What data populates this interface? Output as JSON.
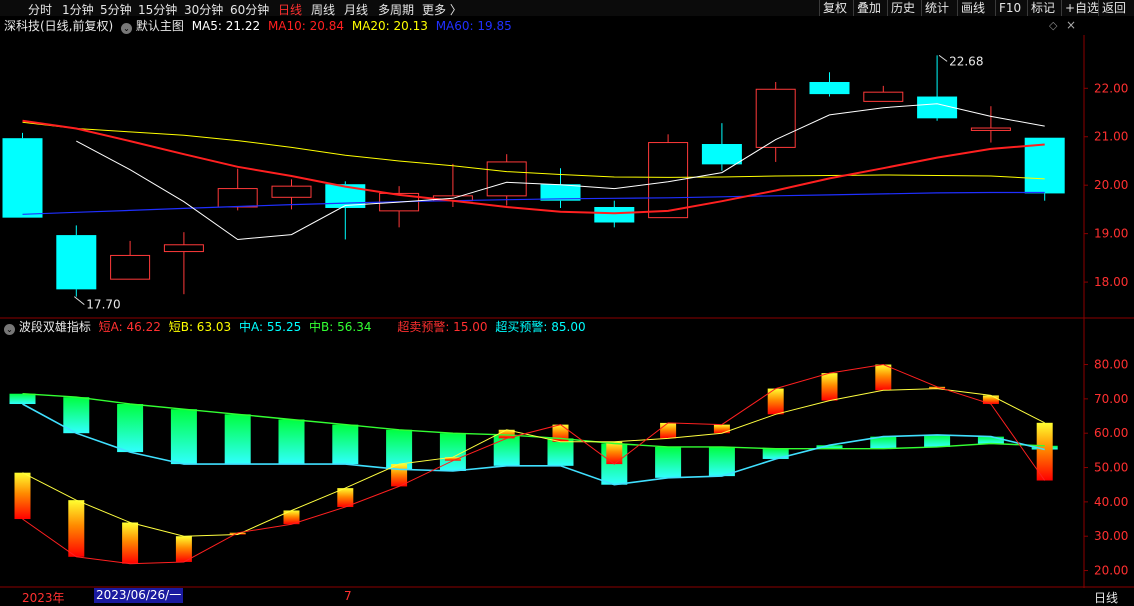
{
  "toolbar": {
    "periods": [
      "分时",
      "1分钟",
      "5分钟",
      "15分钟",
      "30分钟",
      "60分钟",
      "日线",
      "周线",
      "月线",
      "多周期",
      "更多 〉"
    ],
    "active_period": "日线",
    "buttons": [
      "复权",
      "叠加",
      "历史",
      "统计",
      "画线",
      "F10",
      "标记",
      "+自选",
      "返回"
    ]
  },
  "main_info": {
    "stock": "深科技(日线,前复权)",
    "template": "默认主图",
    "ma5": "MA5: 21.22",
    "ma10": "MA10: 20.84",
    "ma20": "MA20: 20.13",
    "ma60": "MA60: 19.85"
  },
  "sub_info": {
    "name": "波段双雄指标",
    "a": "短A: 46.22",
    "b": "短B: 63.03",
    "c": "中A: 55.25",
    "d": "中B: 56.34",
    "oversold": "超卖预警: 15.00",
    "overbought": "超买预警: 85.00"
  },
  "bottom": {
    "year": "2023年",
    "cursor_date": "2023/06/26/一",
    "month": "7",
    "period_label": "日线"
  },
  "colors": {
    "up": "#ff3a3a",
    "down": "#00ffff",
    "ma5": "#ffffff",
    "ma10": "#ff2020",
    "ma20": "#ffff00",
    "ma60": "#1f2fff",
    "axis": "#8b0000"
  },
  "chart_data": [
    {
      "type": "candlestick",
      "title": "深科技(日线,前复权)",
      "ylim": [
        17.3,
        23.1
      ],
      "yticks": [
        "18.00",
        "19.00",
        "20.00",
        "21.00",
        "22.00"
      ],
      "annotations": {
        "high": "22.68",
        "low": "17.70"
      },
      "candles": [
        {
          "o": 20.97,
          "h": 21.08,
          "l": 19.33,
          "c": 19.33
        },
        {
          "o": 18.97,
          "h": 19.17,
          "l": 17.7,
          "c": 17.85
        },
        {
          "o": 18.06,
          "h": 18.85,
          "l": 18.06,
          "c": 18.55
        },
        {
          "o": 18.63,
          "h": 19.03,
          "l": 17.75,
          "c": 18.77
        },
        {
          "o": 19.55,
          "h": 20.34,
          "l": 19.48,
          "c": 19.93
        },
        {
          "o": 19.75,
          "h": 20.12,
          "l": 19.5,
          "c": 19.98
        },
        {
          "o": 20.02,
          "h": 20.08,
          "l": 18.88,
          "c": 19.53
        },
        {
          "o": 19.47,
          "h": 19.98,
          "l": 19.13,
          "c": 19.83
        },
        {
          "o": 19.68,
          "h": 20.44,
          "l": 19.55,
          "c": 19.78
        },
        {
          "o": 19.78,
          "h": 20.64,
          "l": 19.58,
          "c": 20.48
        },
        {
          "o": 20.02,
          "h": 20.35,
          "l": 19.53,
          "c": 19.68
        },
        {
          "o": 19.55,
          "h": 19.68,
          "l": 19.13,
          "c": 19.23
        },
        {
          "o": 19.33,
          "h": 21.05,
          "l": 19.33,
          "c": 20.88
        },
        {
          "o": 20.85,
          "h": 21.28,
          "l": 20.3,
          "c": 20.43
        },
        {
          "o": 20.78,
          "h": 22.13,
          "l": 20.48,
          "c": 21.98
        },
        {
          "o": 22.13,
          "h": 22.33,
          "l": 21.83,
          "c": 21.88
        },
        {
          "o": 21.73,
          "h": 22.05,
          "l": 21.73,
          "c": 21.92
        },
        {
          "o": 21.83,
          "h": 22.68,
          "l": 21.33,
          "c": 21.38
        },
        {
          "o": 21.13,
          "h": 21.63,
          "l": 20.88,
          "c": 21.18
        },
        {
          "o": 20.98,
          "h": 20.98,
          "l": 19.68,
          "c": 19.83
        }
      ],
      "ma5": [
        null,
        20.91,
        20.32,
        19.66,
        18.88,
        18.98,
        19.58,
        19.65,
        19.73,
        20.06,
        20.01,
        19.93,
        20.07,
        20.26,
        20.94,
        21.45,
        21.6,
        21.68,
        21.42,
        21.22
      ],
      "ma10": [
        21.33,
        21.17,
        20.91,
        20.64,
        20.38,
        20.19,
        19.97,
        19.8,
        19.68,
        19.55,
        19.45,
        19.42,
        19.47,
        19.67,
        19.89,
        20.14,
        20.35,
        20.57,
        20.75,
        20.84
      ],
      "ma20": [
        21.3,
        21.17,
        21.1,
        21.03,
        20.92,
        20.78,
        20.62,
        20.5,
        20.4,
        20.28,
        20.22,
        20.17,
        20.16,
        20.17,
        20.19,
        20.2,
        20.21,
        20.2,
        20.19,
        20.13
      ],
      "ma60": [
        19.4,
        19.44,
        19.48,
        19.52,
        19.56,
        19.6,
        19.63,
        19.66,
        19.68,
        19.7,
        19.72,
        19.73,
        19.74,
        19.76,
        19.78,
        19.8,
        19.82,
        19.84,
        19.85,
        19.85
      ]
    },
    {
      "type": "bar",
      "title": "波段双雄指标",
      "ylim": [
        15.5,
        88.6
      ],
      "yticks": [
        "20.00",
        "30.00",
        "40.00",
        "50.00",
        "60.00",
        "70.00",
        "80.00"
      ],
      "series": [
        {
          "name": "短A",
          "values": [
            35.0,
            24.0,
            22.0,
            22.5,
            31.0,
            33.5,
            38.5,
            44.5,
            52.0,
            58.5,
            62.5,
            51.0,
            63.0,
            62.5,
            73.0,
            77.5,
            80.0,
            73.5,
            68.5,
            46.22
          ]
        },
        {
          "name": "短B",
          "values": [
            48.5,
            40.5,
            34.0,
            30.0,
            30.5,
            37.5,
            44.0,
            51.0,
            53.0,
            61.0,
            57.5,
            57.5,
            58.5,
            60.0,
            65.5,
            69.5,
            72.5,
            73.0,
            71.0,
            63.03
          ]
        },
        {
          "name": "中A",
          "values": [
            68.5,
            60.0,
            54.5,
            51.0,
            51.0,
            51.0,
            51.0,
            49.5,
            49.0,
            50.5,
            50.5,
            45.0,
            47.0,
            47.5,
            52.5,
            56.5,
            59.0,
            59.5,
            59.0,
            55.25
          ]
        },
        {
          "name": "中B",
          "values": [
            71.5,
            70.5,
            68.5,
            67.0,
            65.5,
            64.0,
            62.5,
            61.0,
            60.0,
            59.5,
            58.5,
            57.0,
            56.0,
            56.0,
            55.5,
            55.5,
            55.5,
            56.0,
            57.0,
            56.34
          ]
        }
      ]
    }
  ]
}
